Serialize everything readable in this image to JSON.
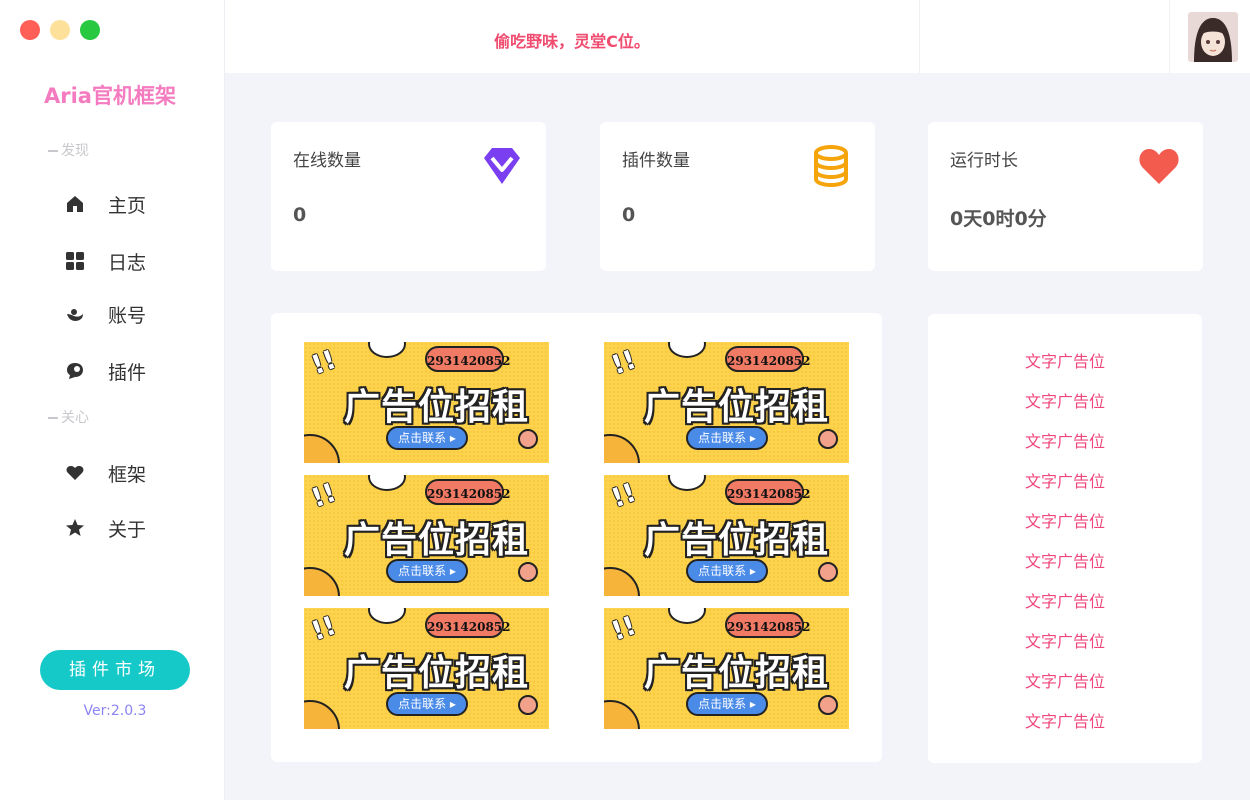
{
  "sidebar": {
    "brand": "Aria官机框架",
    "section_discover": "发现",
    "section_care": "关心",
    "items": [
      {
        "label": "主页",
        "icon": "home-icon"
      },
      {
        "label": "日志",
        "icon": "grid-icon"
      },
      {
        "label": "账号",
        "icon": "account-icon"
      },
      {
        "label": "插件",
        "icon": "chat-icon"
      },
      {
        "label": "框架",
        "icon": "heart-icon"
      },
      {
        "label": "关于",
        "icon": "star-icon"
      }
    ],
    "market_button": "插件市场",
    "version": "Ver:2.0.3"
  },
  "window_controls": {
    "close_color": "#fe5f57",
    "minimize_color": "#fde19a",
    "maximize_color": "#28c840"
  },
  "header": {
    "slogan": "偷吃野味，灵堂C位。",
    "avatar_icon": "user-avatar"
  },
  "stats": [
    {
      "label": "在线数量",
      "value": "0",
      "icon": "diamond-icon",
      "color": "#7a3ff0"
    },
    {
      "label": "插件数量",
      "value": "0",
      "icon": "database-icon",
      "color": "#f5a40b"
    },
    {
      "label": "运行时长",
      "value": "0天0时0分",
      "icon": "heart-icon",
      "color": "#f35b4f"
    }
  ],
  "ads": [
    {
      "title": "广告位招租",
      "qq": "2931420852",
      "button": "点击联系"
    },
    {
      "title": "广告位招租",
      "qq": "2931420852",
      "button": "点击联系"
    },
    {
      "title": "广告位招租",
      "qq": "2931420852",
      "button": "点击联系"
    },
    {
      "title": "广告位招租",
      "qq": "2931420852",
      "button": "点击联系"
    },
    {
      "title": "广告位招租",
      "qq": "2931420852",
      "button": "点击联系"
    },
    {
      "title": "广告位招租",
      "qq": "2931420852",
      "button": "点击联系"
    }
  ],
  "text_ads": [
    "文字广告位",
    "文字广告位",
    "文字广告位",
    "文字广告位",
    "文字广告位",
    "文字广告位",
    "文字广告位",
    "文字广告位",
    "文字广告位",
    "文字广告位"
  ],
  "colors": {
    "accent_pink": "#f47bbf",
    "slogan_red": "#f04c6f",
    "market_teal": "#16c9c9",
    "version_purple": "#8d84f3",
    "text_ad_pink": "#f0467b"
  }
}
